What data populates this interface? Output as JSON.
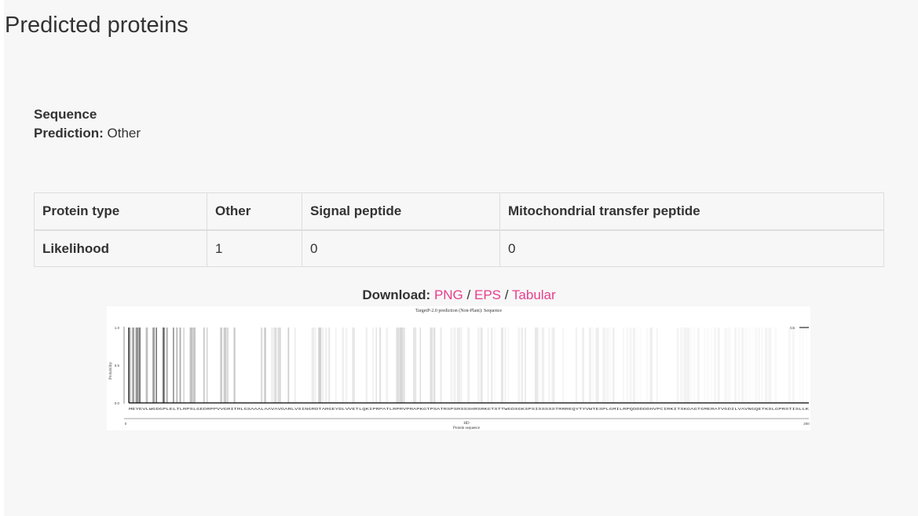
{
  "page": {
    "title": "Predicted proteins"
  },
  "sequence": {
    "label": "Sequence",
    "prediction_label": "Prediction:",
    "prediction_value": "Other"
  },
  "table": {
    "headers": [
      "Protein type",
      "Other",
      "Signal peptide",
      "Mitochondrial transfer peptide"
    ],
    "row": [
      "Likelihood",
      "1",
      "0",
      "0"
    ]
  },
  "download": {
    "label": "Download:",
    "sep": "/",
    "links": [
      "PNG",
      "EPS",
      "Tabular"
    ]
  },
  "plot": {
    "title": "TargetP-2.0 prediction (Non-Plant): Sequence",
    "ylabel": "Probability",
    "xlabel_top": "HD",
    "xlabel_bottom": "Protein sequence",
    "legend": "CS",
    "ticks_y": [
      "1.0",
      "0.5",
      "0.0"
    ],
    "ticks_x": [
      "0",
      "200"
    ],
    "sequence": "MEYEVLWGDGPLELTLRPSLGEDRPPVVGRITRLGSAAALAAVAVGARLVSINGRDTARGEYDLVVETLQKIPRPATLRPRVPRAPKGTPSATRSPSRSSSHRSRKGTSTTWGDSGKSPSISSSSSTRRREQYTYVWTESPLGMILRPQDDDDDHVPCIRKITSKGAGTGMERATVGDILVAVNGQETKSLGPRSTISLLK",
    "grey_density": [
      0.9,
      0.6,
      0.5,
      0.4,
      0.35,
      0.3,
      0.28,
      0.25,
      0.2,
      0.18,
      0.16,
      0.15,
      0.13,
      0.12,
      0.1,
      0.1,
      0.1,
      0.08,
      0.08,
      0.07
    ],
    "colors": {
      "grey": "#555555",
      "line": "#000000"
    }
  }
}
